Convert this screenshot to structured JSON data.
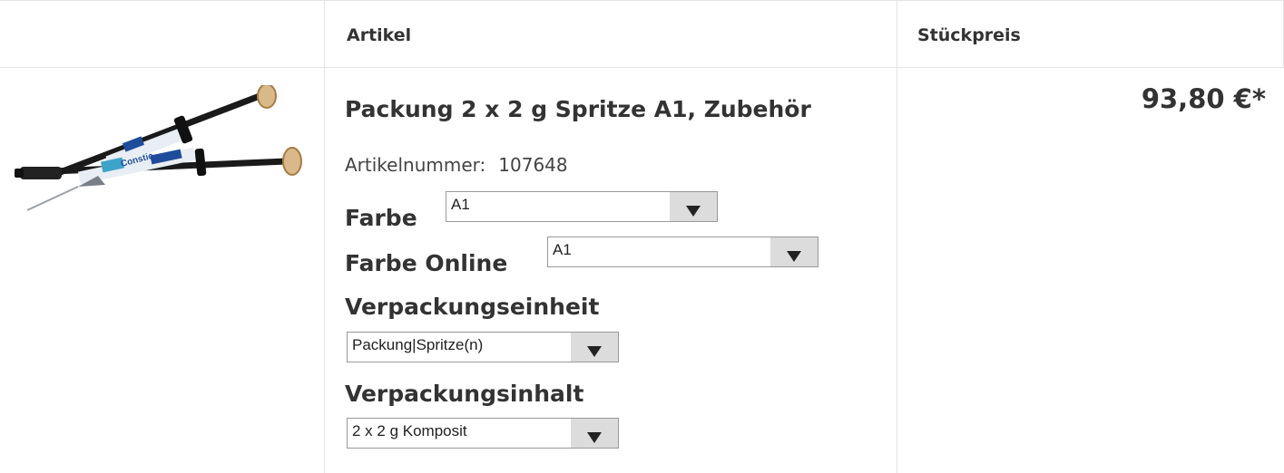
{
  "header": {
    "col_article": "Artikel",
    "col_unit_price": "Stückpreis"
  },
  "product": {
    "title": "Packung 2 x 2 g Spritze A1, Zubehör",
    "article_number_label": "Artikelnummer:",
    "article_number": "107648",
    "price": "93,80 €*",
    "image_label": "Constic"
  },
  "options": {
    "farbe": {
      "label": "Farbe",
      "value": "A1"
    },
    "farbe_online": {
      "label": "Farbe Online",
      "value": "A1"
    },
    "verpackungseinheit": {
      "label": "Verpackungseinheit",
      "value": "Packung|Spritze(n)"
    },
    "verpackungsinhalt": {
      "label": "Verpackungsinhalt",
      "value": "2 x 2 g Komposit"
    }
  }
}
